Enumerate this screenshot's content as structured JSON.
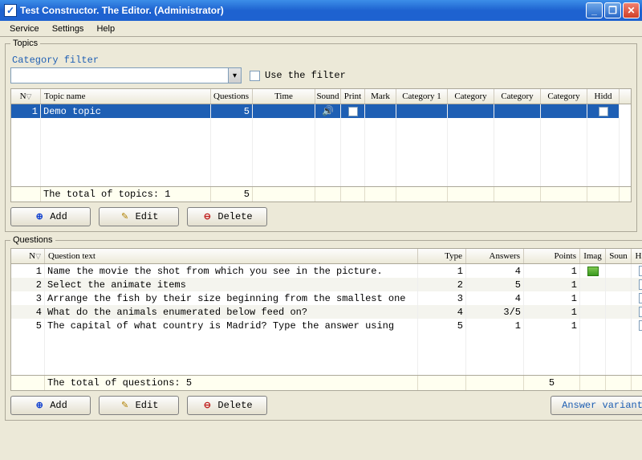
{
  "window": {
    "title": "Test Constructor. The Editor.  (Administrator)"
  },
  "menu": {
    "service": "Service",
    "settings": "Settings",
    "help": "Help"
  },
  "topics": {
    "legend": "Topics",
    "category_filter_label": "Category filter",
    "use_filter_label": "Use the filter",
    "columns": {
      "n": "N",
      "name": "Topic name",
      "questions": "Questions",
      "time": "Time",
      "sound": "Sound",
      "print": "Print",
      "mark": "Mark",
      "cat1": "Category 1",
      "cat2": "Category",
      "cat3": "Category",
      "cat4": "Category",
      "hidden": "Hidd"
    },
    "rows": [
      {
        "n": "1",
        "name": "Demo topic",
        "questions": "5",
        "sound_icon": "🔊"
      }
    ],
    "total_label": "The total of topics: 1",
    "total_questions": "5",
    "add": "Add",
    "edit": "Edit",
    "delete": "Delete"
  },
  "questions": {
    "legend": "Questions",
    "columns": {
      "n": "N",
      "text": "Question text",
      "type": "Type",
      "answers": "Answers",
      "points": "Points",
      "image": "Imag",
      "sound": "Soun",
      "hidden": "Hidd"
    },
    "rows": [
      {
        "n": "1",
        "text": "Name the movie the shot from which you see in the picture.",
        "type": "1",
        "answers": "4",
        "points": "1",
        "image": true
      },
      {
        "n": "2",
        "text": "Select the animate items",
        "type": "2",
        "answers": "5",
        "points": "1",
        "image": false
      },
      {
        "n": "3",
        "text": "Arrange the fish by their size beginning from the smallest one",
        "type": "3",
        "answers": "4",
        "points": "1",
        "image": false
      },
      {
        "n": "4",
        "text": "What do the animals enumerated below feed on?",
        "type": "4",
        "answers": "3/5",
        "points": "1",
        "image": false
      },
      {
        "n": "5",
        "text": "The capital of what country is Madrid? Type the answer using",
        "type": "5",
        "answers": "1",
        "points": "1",
        "image": false
      }
    ],
    "total_label": "The total of questions: 5",
    "total_points": "5",
    "add": "Add",
    "edit": "Edit",
    "delete": "Delete",
    "answer_variants": "Answer variants"
  }
}
